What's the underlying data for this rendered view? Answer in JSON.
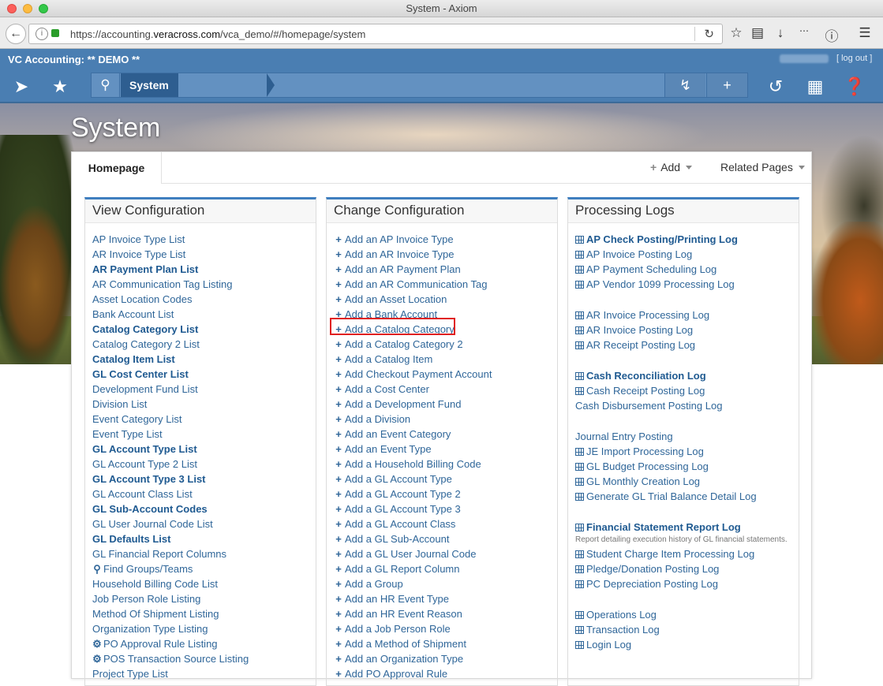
{
  "window": {
    "title": "System - Axiom"
  },
  "browser": {
    "url_prefix": "https://accounting.",
    "url_domain": "veracross.com",
    "url_path": "/vca_demo/#/homepage/system"
  },
  "app": {
    "name": "VC Accounting: ** DEMO **",
    "logout_label": "[ log out ]",
    "breadcrumb": "System"
  },
  "page": {
    "title": "System"
  },
  "tabs": {
    "home": "Homepage",
    "add": "Add",
    "related": "Related Pages"
  },
  "columns": {
    "view": {
      "title": "View Configuration",
      "items": [
        {
          "label": "AP Invoice Type List",
          "bold": false,
          "icon": ""
        },
        {
          "label": "AR Invoice Type List",
          "bold": false,
          "icon": ""
        },
        {
          "label": "AR Payment Plan List",
          "bold": true,
          "icon": ""
        },
        {
          "label": "AR Communication Tag Listing",
          "bold": false,
          "icon": ""
        },
        {
          "label": "Asset Location Codes",
          "bold": false,
          "icon": ""
        },
        {
          "label": "Bank Account List",
          "bold": false,
          "icon": ""
        },
        {
          "label": "Catalog Category List",
          "bold": true,
          "icon": ""
        },
        {
          "label": "Catalog Category 2 List",
          "bold": false,
          "icon": ""
        },
        {
          "label": "Catalog Item List",
          "bold": true,
          "icon": ""
        },
        {
          "label": "GL Cost Center List",
          "bold": true,
          "icon": ""
        },
        {
          "label": "Development Fund List",
          "bold": false,
          "icon": ""
        },
        {
          "label": "Division List",
          "bold": false,
          "icon": ""
        },
        {
          "label": "Event Category List",
          "bold": false,
          "icon": ""
        },
        {
          "label": "Event Type List",
          "bold": false,
          "icon": ""
        },
        {
          "label": "GL Account Type List",
          "bold": true,
          "icon": ""
        },
        {
          "label": "GL Account Type 2 List",
          "bold": false,
          "icon": ""
        },
        {
          "label": "GL Account Type 3 List",
          "bold": true,
          "icon": ""
        },
        {
          "label": "GL Account Class List",
          "bold": false,
          "icon": ""
        },
        {
          "label": "GL Sub-Account Codes",
          "bold": true,
          "icon": ""
        },
        {
          "label": "GL User Journal Code List",
          "bold": false,
          "icon": ""
        },
        {
          "label": "GL Defaults List",
          "bold": true,
          "icon": ""
        },
        {
          "label": "GL Financial Report Columns",
          "bold": false,
          "icon": ""
        },
        {
          "label": "Find Groups/Teams",
          "bold": false,
          "icon": "search"
        },
        {
          "label": "Household Billing Code List",
          "bold": false,
          "icon": ""
        },
        {
          "label": "Job Person Role Listing",
          "bold": false,
          "icon": ""
        },
        {
          "label": "Method Of Shipment Listing",
          "bold": false,
          "icon": ""
        },
        {
          "label": "Organization Type Listing",
          "bold": false,
          "icon": ""
        },
        {
          "label": "PO Approval Rule Listing",
          "bold": false,
          "icon": "gear"
        },
        {
          "label": "POS Transaction Source Listing",
          "bold": false,
          "icon": "gear"
        },
        {
          "label": "Project Type List",
          "bold": false,
          "icon": ""
        }
      ]
    },
    "change": {
      "title": "Change Configuration",
      "items": [
        "Add an AP Invoice Type",
        "Add an AR Invoice Type",
        "Add an AR Payment Plan",
        "Add an AR Communication Tag",
        "Add an Asset Location",
        "Add a Bank Account",
        "Add a Catalog Category",
        "Add a Catalog Category 2",
        "Add a Catalog Item",
        "Add Checkout Payment Account",
        "Add a Cost Center",
        "Add a Development Fund",
        "Add a Division",
        "Add an Event Category",
        "Add an Event Type",
        "Add a Household Billing Code",
        "Add a GL Account Type",
        "Add a GL Account Type 2",
        "Add a GL Account Type 3",
        "Add a GL Account Class",
        "Add a GL Sub-Account",
        "Add a GL User Journal Code",
        "Add a GL Report Column",
        "Add a Group",
        "Add an HR Event Type",
        "Add an HR Event Reason",
        "Add a Job Person Role",
        "Add a Method of Shipment",
        "Add an Organization Type",
        "Add PO Approval Rule"
      ]
    },
    "logs": {
      "title": "Processing Logs",
      "items": [
        {
          "label": "AP Check Posting/Printing Log",
          "bold": true,
          "icon": "grid"
        },
        {
          "label": "AP Invoice Posting Log",
          "bold": false,
          "icon": "grid"
        },
        {
          "label": "AP Payment Scheduling Log",
          "bold": false,
          "icon": "grid"
        },
        {
          "label": "AP Vendor 1099 Processing Log",
          "bold": false,
          "icon": "grid"
        },
        {
          "label": "",
          "gap": true
        },
        {
          "label": "AR Invoice Processing Log",
          "bold": false,
          "icon": "grid"
        },
        {
          "label": "AR Invoice Posting Log",
          "bold": false,
          "icon": "grid"
        },
        {
          "label": "AR Receipt Posting Log",
          "bold": false,
          "icon": "grid"
        },
        {
          "label": "",
          "gap": true
        },
        {
          "label": "Cash Reconciliation Log",
          "bold": true,
          "icon": "grid"
        },
        {
          "label": "Cash Receipt Posting Log",
          "bold": false,
          "icon": "grid"
        },
        {
          "label": "Cash Disbursement Posting Log",
          "bold": false,
          "icon": ""
        },
        {
          "label": "",
          "gap": true
        },
        {
          "label": "Journal Entry Posting",
          "bold": false,
          "icon": ""
        },
        {
          "label": "JE Import Processing Log",
          "bold": false,
          "icon": "grid"
        },
        {
          "label": "GL Budget Processing Log",
          "bold": false,
          "icon": "grid"
        },
        {
          "label": "GL Monthly Creation Log",
          "bold": false,
          "icon": "grid"
        },
        {
          "label": "Generate GL Trial Balance Detail Log",
          "bold": false,
          "icon": "grid"
        },
        {
          "label": "",
          "gap": true
        },
        {
          "label": "Financial Statement Report Log",
          "bold": true,
          "icon": "grid"
        },
        {
          "label": "Report detailing execution history of GL financial statements.",
          "small": true
        },
        {
          "label": "Student Charge Item Processing Log",
          "bold": false,
          "icon": "grid"
        },
        {
          "label": "Pledge/Donation Posting Log",
          "bold": false,
          "icon": "grid"
        },
        {
          "label": "PC Depreciation Posting Log",
          "bold": false,
          "icon": "grid"
        },
        {
          "label": "",
          "gap": true
        },
        {
          "label": "Operations Log",
          "bold": false,
          "icon": "grid"
        },
        {
          "label": "Transaction Log",
          "bold": false,
          "icon": "grid"
        },
        {
          "label": "Login Log",
          "bold": false,
          "icon": "grid"
        }
      ]
    }
  },
  "highlighted_item": "Add a Catalog Category",
  "colors": {
    "appbar": "#4a7eb2",
    "link": "#2f6699",
    "accent_border": "#3f7fbf",
    "highlight": "#e02020"
  }
}
